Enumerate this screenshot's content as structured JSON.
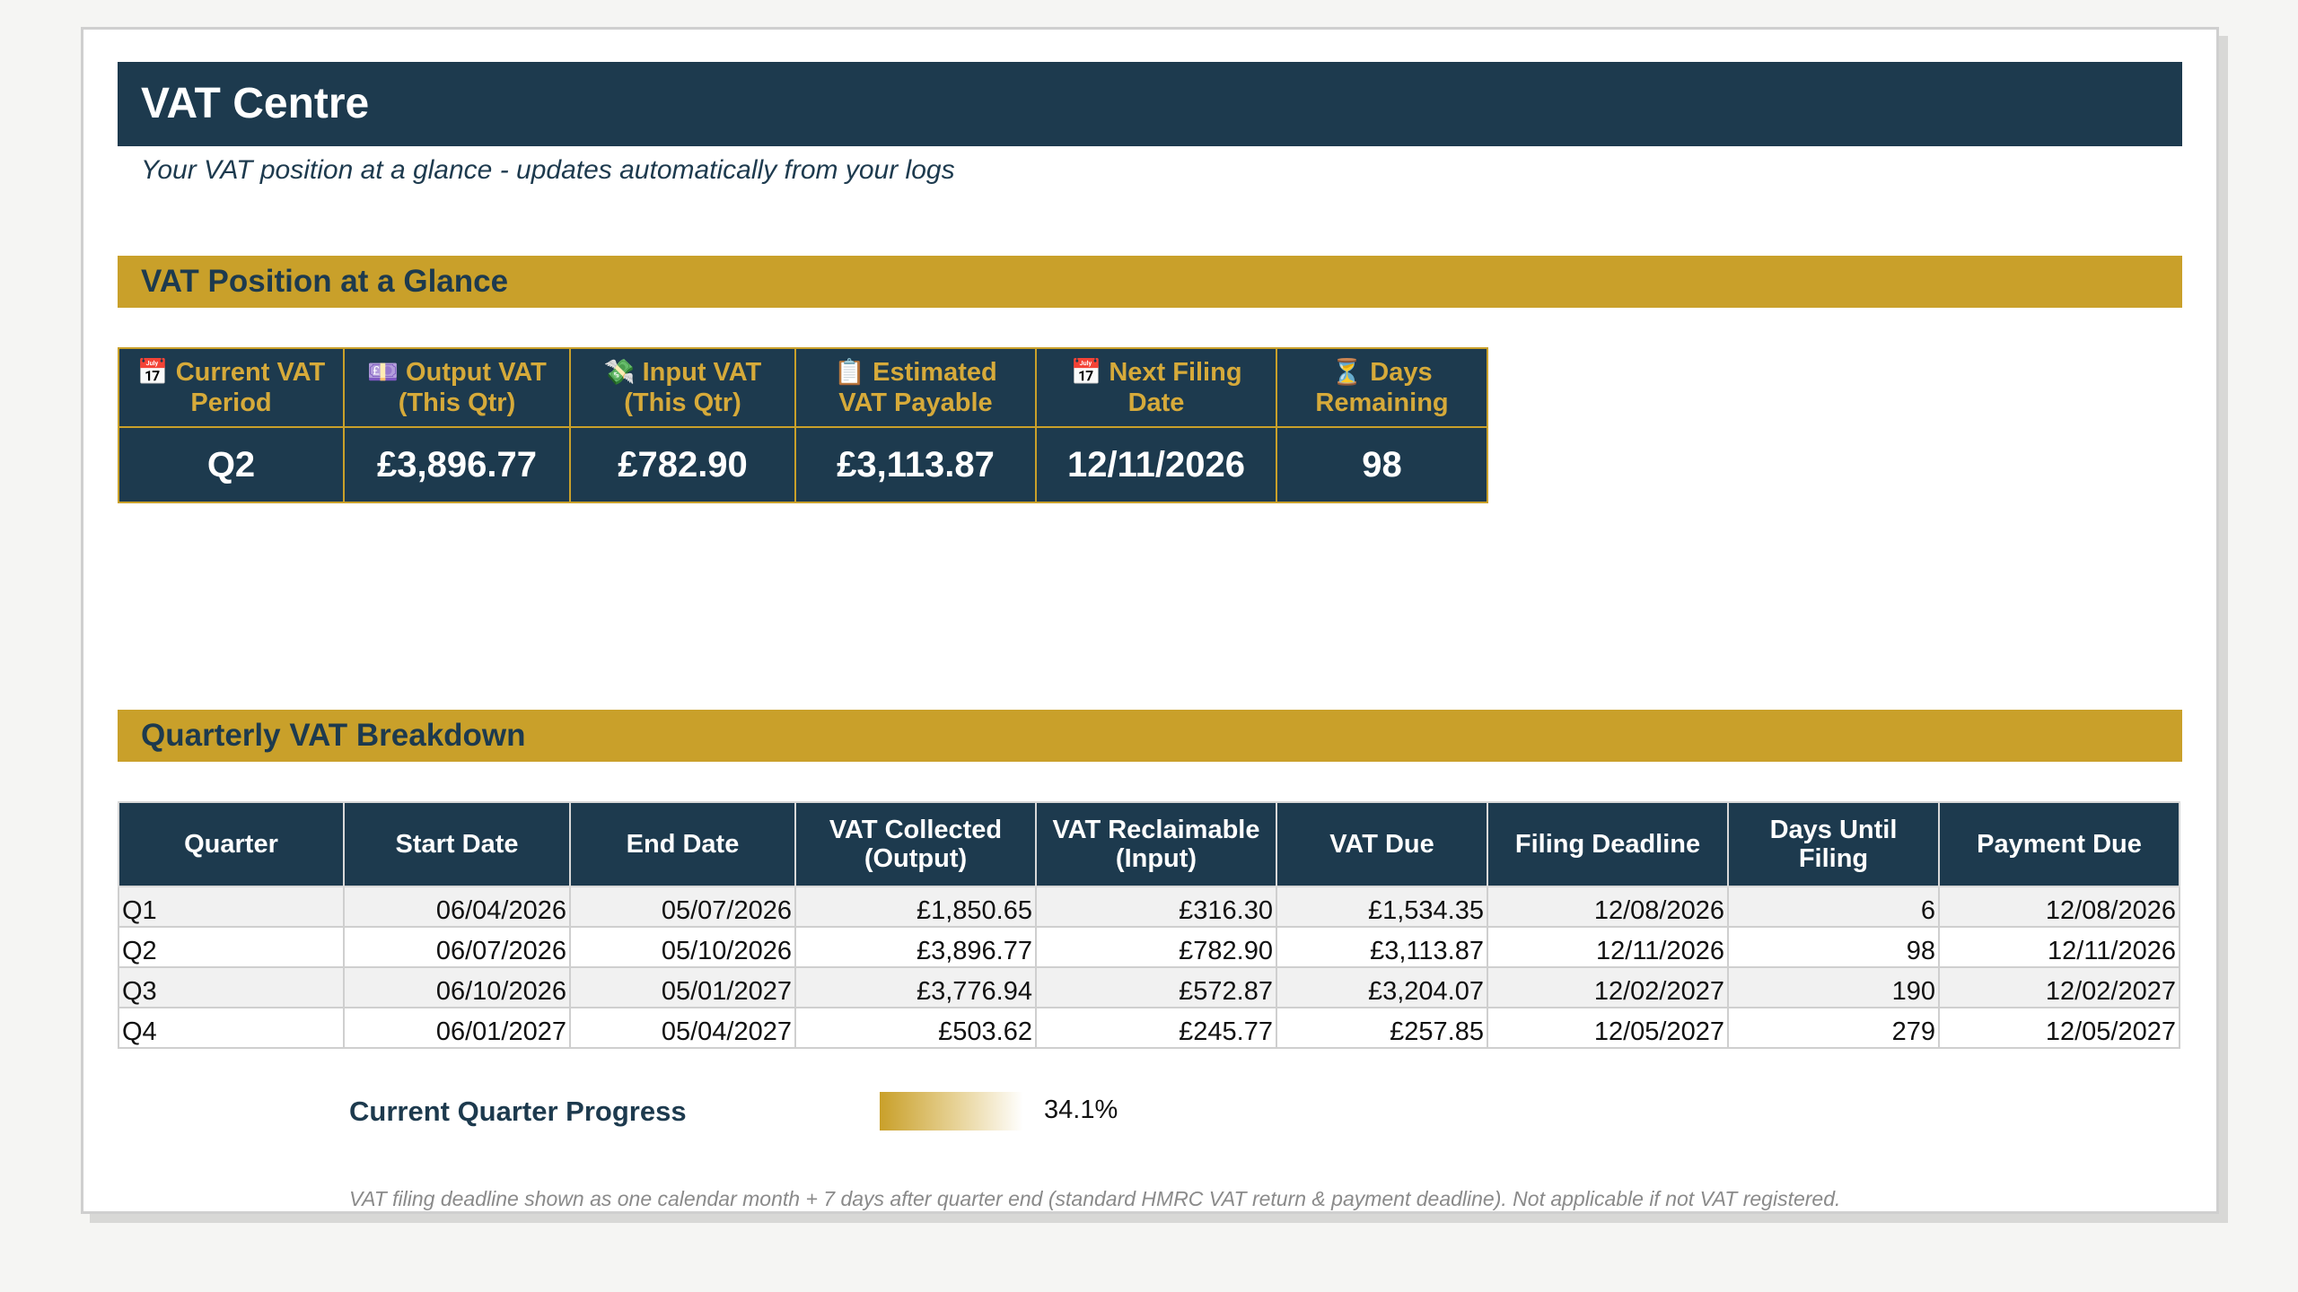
{
  "header": {
    "title": "VAT Centre",
    "subtitle": "Your VAT position at a glance - updates automatically from your logs"
  },
  "glance": {
    "section_title": "VAT Position at a Glance",
    "cards": [
      {
        "icon": "📅",
        "icon_name": "calendar-icon",
        "label_line1": "Current VAT",
        "label_line2": "Period",
        "value": "Q2"
      },
      {
        "icon": "💷",
        "icon_name": "banknote-icon",
        "label_line1": "Output VAT",
        "label_line2": "(This Qtr)",
        "value": "£3,896.77"
      },
      {
        "icon": "💸",
        "icon_name": "money-wings-icon",
        "label_line1": "Input VAT",
        "label_line2": "(This Qtr)",
        "value": "£782.90"
      },
      {
        "icon": "📋",
        "icon_name": "clipboard-icon",
        "label_line1": "Estimated",
        "label_line2": "VAT Payable",
        "value": "£3,113.87"
      },
      {
        "icon": "📅",
        "icon_name": "calendar-icon",
        "label_line1": "Next Filing",
        "label_line2": "Date",
        "value": "12/11/2026"
      },
      {
        "icon": "⏳",
        "icon_name": "hourglass-icon",
        "label_line1": "Days",
        "label_line2": "Remaining",
        "value": "98"
      }
    ]
  },
  "breakdown": {
    "section_title": "Quarterly VAT Breakdown",
    "columns": [
      {
        "line1": "Quarter",
        "line2": ""
      },
      {
        "line1": "Start Date",
        "line2": ""
      },
      {
        "line1": "End Date",
        "line2": ""
      },
      {
        "line1": "VAT Collected",
        "line2": "(Output)"
      },
      {
        "line1": "VAT Reclaimable",
        "line2": "(Input)"
      },
      {
        "line1": "VAT Due",
        "line2": ""
      },
      {
        "line1": "Filing Deadline",
        "line2": ""
      },
      {
        "line1": "Days Until",
        "line2": "Filing"
      },
      {
        "line1": "Payment Due",
        "line2": ""
      }
    ],
    "rows": [
      [
        "Q1",
        "06/04/2026",
        "05/07/2026",
        "£1,850.65",
        "£316.30",
        "£1,534.35",
        "12/08/2026",
        "6",
        "12/08/2026"
      ],
      [
        "Q2",
        "06/07/2026",
        "05/10/2026",
        "£3,896.77",
        "£782.90",
        "£3,113.87",
        "12/11/2026",
        "98",
        "12/11/2026"
      ],
      [
        "Q3",
        "06/10/2026",
        "05/01/2027",
        "£3,776.94",
        "£572.87",
        "£3,204.07",
        "12/02/2027",
        "190",
        "12/02/2027"
      ],
      [
        "Q4",
        "06/01/2027",
        "05/04/2027",
        "£503.62",
        "£245.77",
        "£257.85",
        "12/05/2027",
        "279",
        "12/05/2027"
      ]
    ]
  },
  "progress": {
    "label": "Current Quarter Progress",
    "value_text": "34.1%",
    "fraction": 0.341
  },
  "footnote": "VAT filing deadline shown as one calendar month + 7 days after quarter end (standard HMRC VAT return & payment deadline). Not applicable if not VAT registered.",
  "colors": {
    "navy": "#1d3a4e",
    "gold": "#c9a02a",
    "gold_text": "#d6aa3a"
  }
}
